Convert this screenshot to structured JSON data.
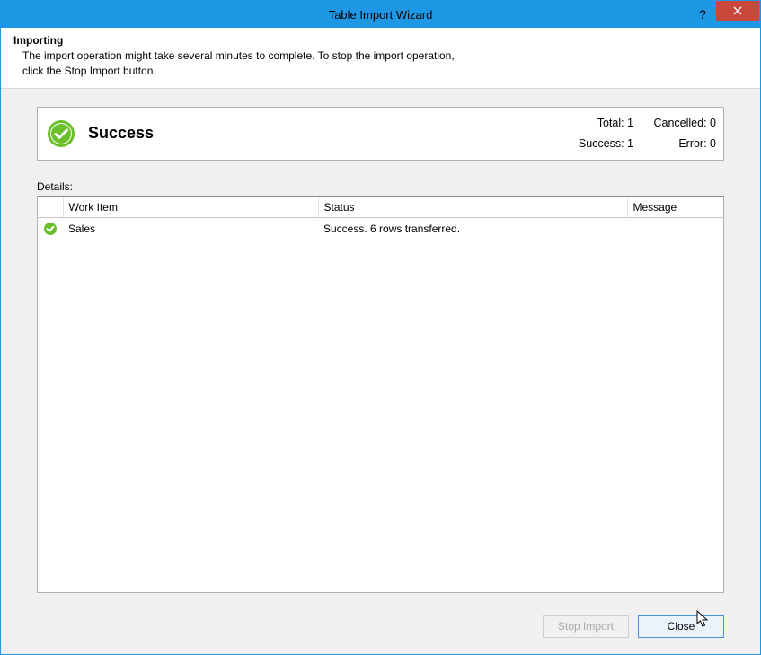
{
  "window": {
    "title": "Table Import Wizard"
  },
  "header": {
    "title": "Importing",
    "description_line1": "The import operation might take several minutes to complete. To stop the import operation,",
    "description_line2": "click the Stop Import button."
  },
  "status": {
    "label": "Success",
    "total_label": "Total: 1",
    "cancelled_label": "Cancelled: 0",
    "success_label": "Success: 1",
    "error_label": "Error: 0"
  },
  "details": {
    "label": "Details:",
    "columns": {
      "work_item": "Work Item",
      "status": "Status",
      "message": "Message"
    },
    "rows": [
      {
        "work_item": "Sales",
        "status": "Success. 6 rows transferred.",
        "message": ""
      }
    ]
  },
  "footer": {
    "stop_import_label": "Stop Import",
    "close_label": "Close"
  }
}
